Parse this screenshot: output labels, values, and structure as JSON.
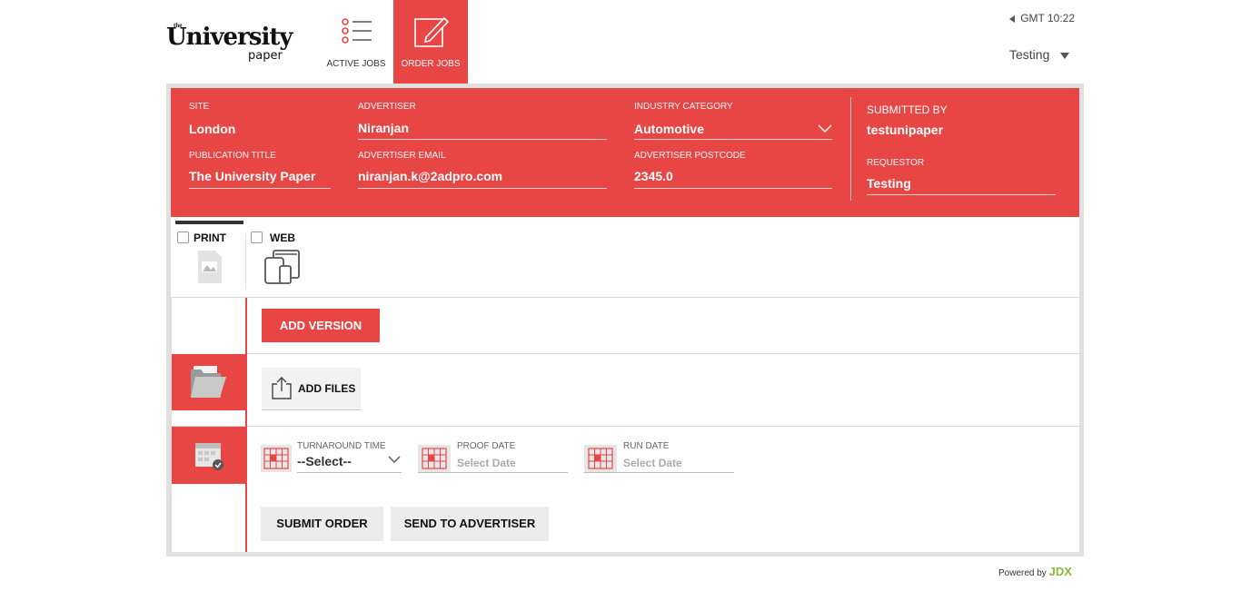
{
  "header": {
    "logo": {
      "the": "the",
      "university": "University",
      "paper": "paper"
    },
    "nav": [
      {
        "label": "ACTIVE JOBS",
        "icon": "list-icon"
      },
      {
        "label": "ORDER JOBS",
        "icon": "edit-icon",
        "active": true
      }
    ],
    "clock": "GMT 10:22",
    "user": "Testing"
  },
  "order": {
    "site": {
      "label": "SITE",
      "value": "London"
    },
    "publication": {
      "label": "PUBLICATION TITLE",
      "value": "The University Paper"
    },
    "advertiser": {
      "label": "ADVERTISER",
      "value": "Niranjan"
    },
    "advertiser_email": {
      "label": "ADVERTISER EMAIL",
      "value": "niranjan.k@2adpro.com"
    },
    "industry": {
      "label": "INDUSTRY CATEGORY",
      "value": "Automotive"
    },
    "postcode": {
      "label": "ADVERTISER POSTCODE",
      "value": "2345.0"
    },
    "submitted_by": {
      "label": "SUBMITTED BY",
      "value": "testunipaper"
    },
    "requestor": {
      "label": "REQUESTOR",
      "value": "Testing"
    }
  },
  "media_tabs": [
    {
      "label": "PRINT",
      "icon": "print-ad-icon"
    },
    {
      "label": "WEB",
      "icon": "devices-icon"
    }
  ],
  "actions": {
    "add_version": "ADD VERSION",
    "add_files": "ADD FILES",
    "submit": "SUBMIT ORDER",
    "send": "SEND TO ADVERTISER"
  },
  "dates": {
    "turnaround": {
      "label": "TURNAROUND TIME",
      "value": "--Select--"
    },
    "proof": {
      "label": "PROOF DATE",
      "placeholder": "Select Date"
    },
    "run": {
      "label": "RUN DATE",
      "placeholder": "Select Date"
    }
  },
  "footer": {
    "powered": "Powered by",
    "brand": "JDX"
  },
  "colors": {
    "accent": "#e84545",
    "brand_green": "#8ab83a"
  }
}
